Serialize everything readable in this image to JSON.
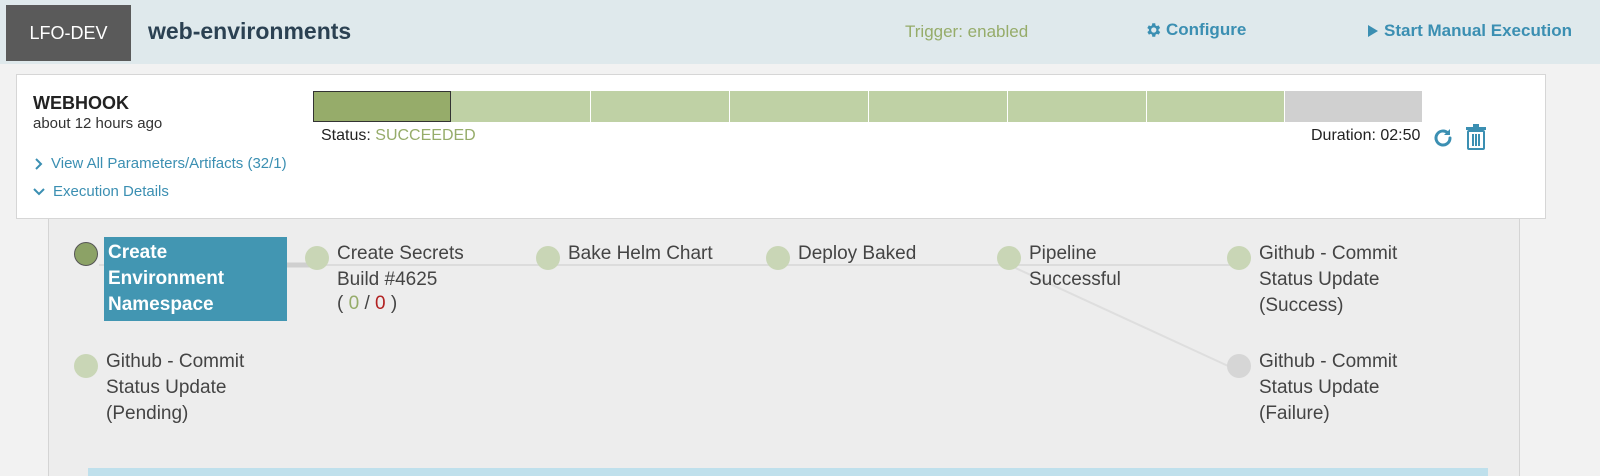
{
  "header": {
    "app_name": "LFO-DEV",
    "pipeline_name": "web-environments",
    "trigger_status": "Trigger: enabled",
    "configure_label": "Configure",
    "start_manual_label": "Start Manual Execution"
  },
  "execution": {
    "trigger_type": "WEBHOOK",
    "time_ago": "about 12 hours ago",
    "status_label": "Status:",
    "status_value": "SUCCEEDED",
    "duration": "Duration: 02:50",
    "params_link": "View All Parameters/Artifacts (32/1)",
    "details_link": "Execution Details",
    "progress_segments": [
      "active",
      "done",
      "done",
      "done",
      "done",
      "done",
      "done",
      "pending"
    ]
  },
  "stages": {
    "create_ns": "Create\nEnvironment\nNamespace",
    "create_secrets": "Create Secrets\nBuild #4625",
    "secrets_counts": {
      "ok": "0",
      "bad": "0"
    },
    "bake": "Bake Helm Chart",
    "deploy": "Deploy Baked",
    "pipeline_ok": "Pipeline\nSuccessful",
    "gh_success": "Github - Commit\nStatus Update\n(Success)",
    "gh_pending": "Github - Commit\nStatus Update\n(Pending)",
    "gh_failure": "Github - Commit\nStatus Update\n(Failure)"
  },
  "colors": {
    "accent": "#3b8fb2",
    "success": "#96ac6a",
    "selected": "#4296b2",
    "failure": "#b22222"
  },
  "icons": [
    "gear-icon",
    "play-icon",
    "chevron-right-icon",
    "chevron-down-icon",
    "refresh-icon",
    "trash-icon"
  ]
}
